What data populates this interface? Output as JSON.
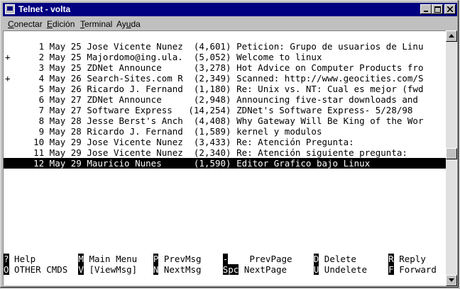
{
  "window": {
    "title": "Telnet - volta"
  },
  "menubar": [
    {
      "pre": "",
      "u": "C",
      "rest": "onectar"
    },
    {
      "pre": "",
      "u": "E",
      "rest": "dición"
    },
    {
      "pre": "",
      "u": "T",
      "rest": "erminal"
    },
    {
      "pre": "Ay",
      "u": "u",
      "rest": "da"
    }
  ],
  "messages": [
    {
      "mark": "",
      "text": "     1 May 25 Jose Vicente Nunez  (4,601) Peticion: Grupo de usuarios de Linu"
    },
    {
      "mark": "+",
      "text": "     2 May 25 Majordomo@ing.ula.  (5,052) Welcome to linux"
    },
    {
      "mark": "",
      "text": "     3 May 25 ZDNet Announce      (3,278) Hot Advice on Computer Products fro"
    },
    {
      "mark": "+",
      "text": "     4 May 26 Search-Sites.com R  (2,349) Scanned: http://www.geocities.com/S"
    },
    {
      "mark": "",
      "text": "     5 May 26 Ricardo J. Fernand  (1,180) Re: Unix vs. NT: Cual es mejor (fwd"
    },
    {
      "mark": "",
      "text": "     6 May 27 ZDNet Announce      (2,948) Announcing five-star downloads and"
    },
    {
      "mark": "",
      "text": "     7 May 27 Software Express   (14,254) ZDNet's Software Express- 5/28/98"
    },
    {
      "mark": "",
      "text": "     8 May 28 Jesse Berst's Anch  (4,408) Why Gateway Will Be King of the Wor"
    },
    {
      "mark": "",
      "text": "     9 May 28 Ricardo J. Fernand  (1,589) kernel y modulos"
    },
    {
      "mark": "",
      "text": "    10 May 29 Jose Vicente Nunez  (3,433) Re: Atención Pregunta:"
    },
    {
      "mark": "",
      "text": "    11 May 29 Jose Vicente Nunez  (2,340) Re: Atención siguiente pregunta:"
    },
    {
      "mark": "",
      "text": "    12 May 29 Mauricio Nunes      (1,590) Editor Grafico bajo Linux",
      "selected": true
    }
  ],
  "commands": {
    "row1": [
      {
        "key": "?",
        "label": " Help",
        "col": 0
      },
      {
        "key": "M",
        "label": " Main Menu",
        "col": 14
      },
      {
        "key": "P",
        "label": " PrevMsg",
        "col": 28
      },
      {
        "key": "-",
        "label": "    PrevPage",
        "col": 41
      },
      {
        "key": "D",
        "label": " Delete",
        "col": 58
      },
      {
        "key": "R",
        "label": " Reply",
        "col": 72
      }
    ],
    "row2": [
      {
        "key": "O",
        "label": " OTHER CMDS",
        "col": 0
      },
      {
        "key": "V",
        "label": " [ViewMsg]",
        "col": 14
      },
      {
        "key": "N",
        "label": " NextMsg",
        "col": 28
      },
      {
        "key": "Spc",
        "label": " NextPage",
        "col": 41
      },
      {
        "key": "U",
        "label": " Undelete",
        "col": 58
      },
      {
        "key": "F",
        "label": " Forward",
        "col": 72
      }
    ]
  }
}
